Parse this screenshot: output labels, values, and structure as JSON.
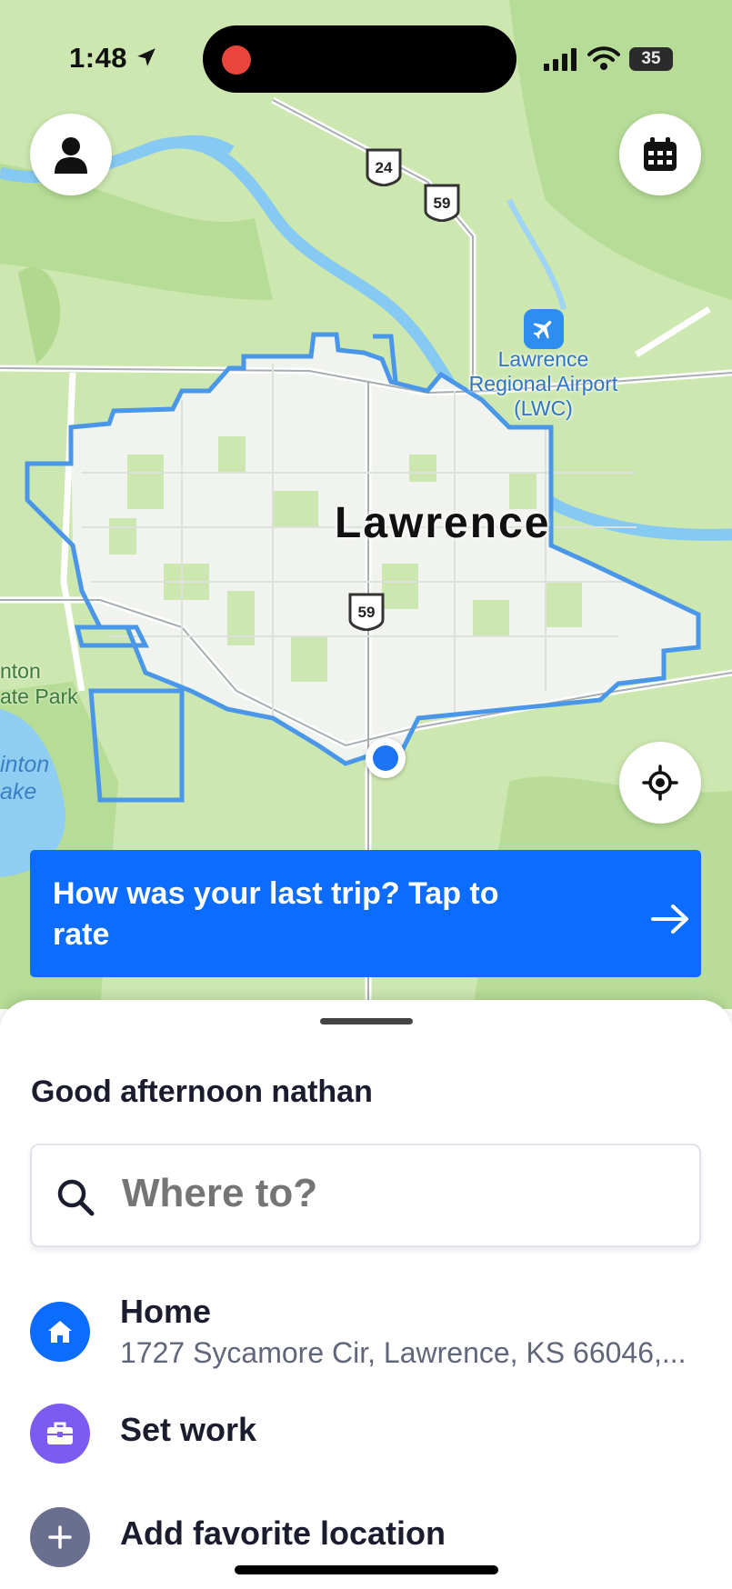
{
  "status_bar": {
    "time": "1:48",
    "battery": "35"
  },
  "map": {
    "city": "Lawrence",
    "airport": "Lawrence Regional Airport (LWC)",
    "park": "nton\nate Park",
    "lake": "inton\nake",
    "shields": [
      "24",
      "59",
      "59"
    ]
  },
  "rate_banner": {
    "text": "How was your last trip? Tap to rate"
  },
  "sheet": {
    "greeting": "Good afternoon nathan",
    "search": {
      "placeholder": "Where to?"
    },
    "favorites": [
      {
        "title": "Home",
        "subtitle": "1727 Sycamore Cir, Lawrence, KS 66046,...",
        "icon": "home-icon",
        "color": "#0b6cff"
      },
      {
        "title": "Set work",
        "icon": "briefcase-icon",
        "color": "#7c5cf0"
      },
      {
        "title": "Add favorite location",
        "icon": "plus-icon",
        "color": "#6b6f8f"
      }
    ]
  },
  "colors": {
    "accent": "#0b6cff",
    "boundary": "#4a97ea",
    "land": "#cde7b0",
    "river": "#7fc3f0"
  }
}
